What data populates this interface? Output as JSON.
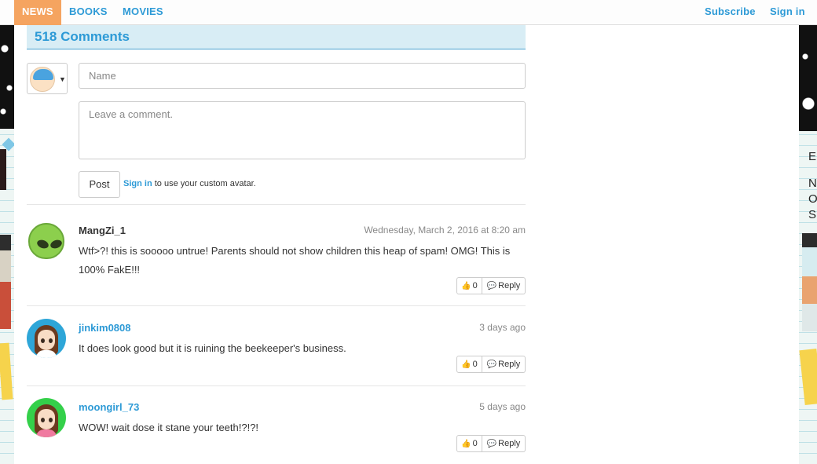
{
  "nav": {
    "tabs": [
      "NEWS",
      "BOOKS",
      "MOVIES"
    ],
    "subscribe": "Subscribe",
    "signin": "Sign in"
  },
  "comments": {
    "header": "518 Comments",
    "name_placeholder": "Name",
    "comment_placeholder": "Leave a comment.",
    "post_label": "Post",
    "signin_link": "Sign in",
    "signin_suffix": "to use your custom avatar."
  },
  "items": [
    {
      "author": "MangZi_1",
      "time": "Wednesday, March 2, 2016 at 8:20 am",
      "text": "Wtf>?! this is sooooo untrue! Parents should not show children this heap of spam! OMG! This is 100% FakE!!!",
      "votes": "0",
      "reply": "Reply"
    },
    {
      "author": "jinkim0808",
      "time": "3 days ago",
      "text": "It does look good but it is ruining the beekeeper's business.",
      "votes": "0",
      "reply": "Reply"
    },
    {
      "author": "moongirl_73",
      "time": "5 days ago",
      "text": "WOW! wait dose it stane your teeth!?!?!",
      "votes": "0",
      "reply": "Reply"
    }
  ],
  "side_right": {
    "letters": [
      "E",
      "N",
      "O",
      "S"
    ]
  },
  "colors": {
    "accent": "#2d9ad6",
    "active_tab": "#f5a460",
    "header_bg": "#d8edf5"
  }
}
